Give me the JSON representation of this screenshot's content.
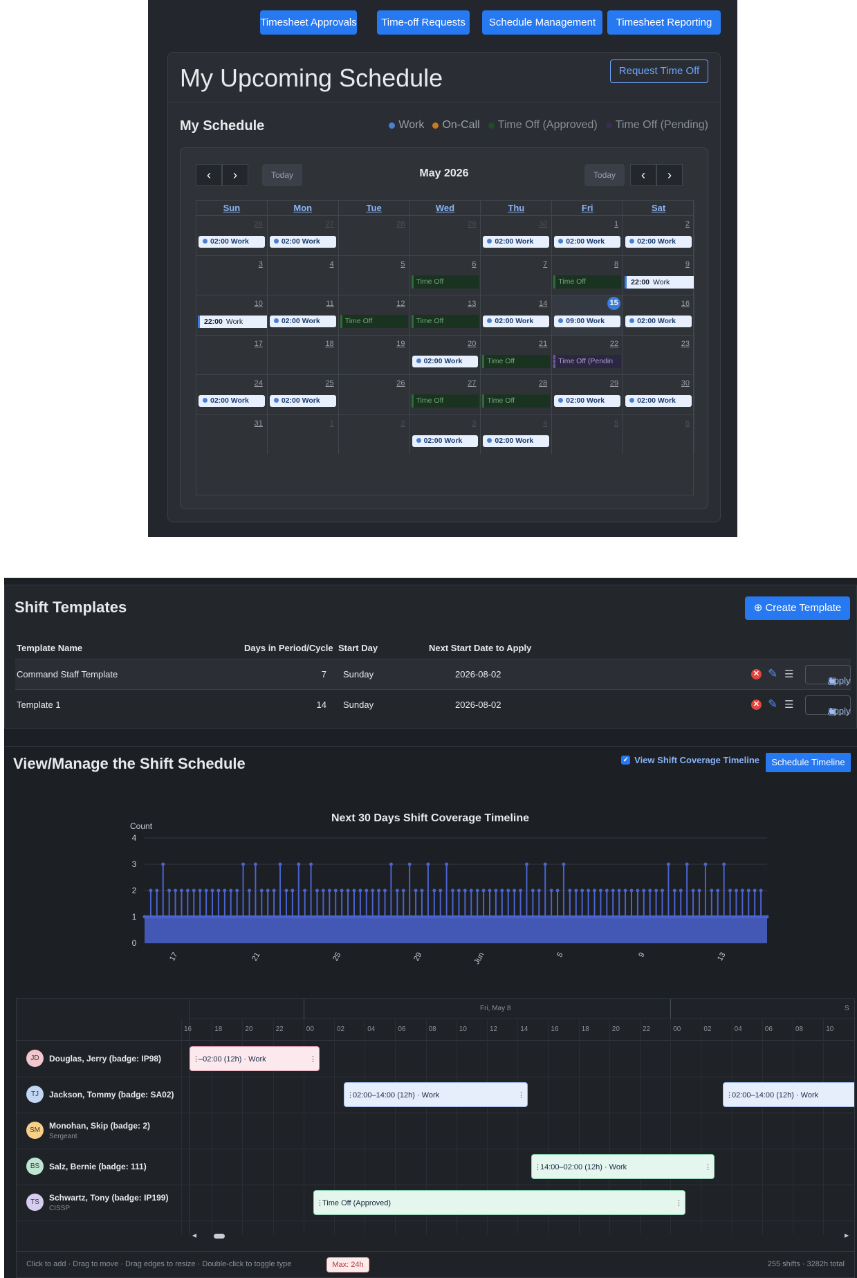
{
  "nav": {
    "buttons": [
      "Timesheet Approvals",
      "Time-off Requests",
      "Schedule Management",
      "Timesheet Reporting"
    ]
  },
  "schedule": {
    "title": "My Upcoming Schedule",
    "request_time_off": "Request Time Off",
    "subtitle": "My Schedule",
    "legend": [
      {
        "label": "Work",
        "color": "#4a7fd1"
      },
      {
        "label": "On-Call",
        "color": "#c77a1e"
      },
      {
        "label": "Time Off (Approved)",
        "color": "#1e4d26"
      },
      {
        "label": "Time Off (Pending)",
        "color": "#3a2d55"
      }
    ],
    "today_label": "Today",
    "month_label": "May 2026",
    "weekdays": [
      "Sun",
      "Mon",
      "Tue",
      "Wed",
      "Thu",
      "Fri",
      "Sat"
    ],
    "weeks": [
      [
        {
          "day": "26",
          "other": true,
          "ev": "w",
          "text": "02:00 Work"
        },
        {
          "day": "27",
          "other": true,
          "ev": "w",
          "text": "02:00 Work"
        },
        {
          "day": "28",
          "other": true
        },
        {
          "day": "29",
          "other": true
        },
        {
          "day": "30",
          "other": true,
          "ev": "w",
          "text": "02:00 Work"
        },
        {
          "day": "1",
          "ev": "w",
          "text": "02:00 Work"
        },
        {
          "day": "2",
          "ev": "w",
          "text": "02:00 Work"
        }
      ],
      [
        {
          "day": "3"
        },
        {
          "day": "4"
        },
        {
          "day": "5"
        },
        {
          "day": "6",
          "ev": "to",
          "text": "Time Off"
        },
        {
          "day": "7"
        },
        {
          "day": "8",
          "ev": "to",
          "text": "Time Off"
        },
        {
          "day": "9",
          "ev": "n",
          "time": "22:00",
          "text": "Work"
        }
      ],
      [
        {
          "day": "10",
          "ev": "n",
          "time": "22:00",
          "text": "Work"
        },
        {
          "day": "11",
          "ev": "w",
          "text": "02:00 Work"
        },
        {
          "day": "12",
          "ev": "to",
          "text": "Time Off"
        },
        {
          "day": "13",
          "ev": "to",
          "text": "Time Off"
        },
        {
          "day": "14",
          "ev": "w",
          "text": "02:00 Work"
        },
        {
          "day": "15",
          "today": true,
          "ev": "w",
          "text": "09:00 Work"
        },
        {
          "day": "16",
          "ev": "w",
          "text": "02:00 Work"
        }
      ],
      [
        {
          "day": "17"
        },
        {
          "day": "18"
        },
        {
          "day": "19"
        },
        {
          "day": "20",
          "ev": "w",
          "text": "02:00 Work"
        },
        {
          "day": "21",
          "ev": "to",
          "text": "Time Off"
        },
        {
          "day": "22",
          "ev": "tp",
          "text": "Time Off (Pendin"
        },
        {
          "day": "23"
        }
      ],
      [
        {
          "day": "24",
          "ev": "w",
          "text": "02:00 Work"
        },
        {
          "day": "25",
          "ev": "w",
          "text": "02:00 Work"
        },
        {
          "day": "26"
        },
        {
          "day": "27",
          "ev": "to",
          "text": "Time Off"
        },
        {
          "day": "28",
          "ev": "to",
          "text": "Time Off"
        },
        {
          "day": "29",
          "ev": "w",
          "text": "02:00 Work"
        },
        {
          "day": "30",
          "ev": "w",
          "text": "02:00 Work"
        }
      ],
      [
        {
          "day": "31"
        },
        {
          "day": "1",
          "other": true
        },
        {
          "day": "2",
          "other": true
        },
        {
          "day": "3",
          "other": true,
          "ev": "w",
          "text": "02:00 Work"
        },
        {
          "day": "4",
          "other": true,
          "ev": "w",
          "text": "02:00 Work"
        },
        {
          "day": "5",
          "other": true
        },
        {
          "day": "6",
          "other": true
        }
      ]
    ]
  },
  "templates": {
    "title": "Shift Templates",
    "create_label": "Create Template",
    "columns": [
      "Template Name",
      "Days in Period/Cycle",
      "Start Day",
      "Next Start Date to Apply"
    ],
    "rows": [
      {
        "name": "Command Staff Template",
        "days": "7",
        "start_day": "Sunday",
        "next": "2026-08-02"
      },
      {
        "name": "Template 1",
        "days": "14",
        "start_day": "Sunday",
        "next": "2026-08-02"
      }
    ],
    "apply_label": "Apply"
  },
  "manage": {
    "title": "View/Manage the Shift Schedule",
    "checkbox_label": "View Shift Coverage Timeline",
    "schedule_timeline_label": "Schedule Timeline"
  },
  "chart_data": {
    "type": "area",
    "title": "Next 30 Days Shift Coverage Timeline",
    "ylabel": "Count",
    "xlabel": "",
    "ylim": [
      0,
      4
    ],
    "yticks": [
      "0",
      "1",
      "2",
      "3",
      "4"
    ],
    "xticks": [
      "17",
      "21",
      "25",
      "29",
      "Jun",
      "5",
      "9",
      "13"
    ],
    "series": [
      {
        "values": [
          1,
          2,
          2,
          3,
          2,
          2,
          2,
          2,
          2,
          2,
          2,
          2,
          2,
          2,
          2,
          2,
          3,
          2,
          3,
          2,
          2,
          2,
          3,
          2,
          2,
          3,
          2,
          3,
          2,
          2,
          2,
          2,
          2,
          2,
          2,
          2,
          2,
          2,
          2,
          2,
          3,
          2,
          2,
          3,
          2,
          2,
          3,
          2,
          2,
          3,
          2,
          2,
          2,
          2,
          2,
          2,
          2,
          2,
          2,
          2,
          2,
          2,
          3,
          2,
          2,
          3,
          2,
          2,
          3,
          2,
          2,
          2,
          2,
          2,
          2,
          2,
          2,
          2,
          2,
          2,
          2,
          2,
          2,
          2,
          2,
          3,
          2,
          2,
          3,
          2,
          2,
          3,
          2,
          2,
          3,
          2,
          2,
          2,
          2,
          2,
          2,
          1
        ]
      }
    ]
  },
  "timeline": {
    "date_label": "Fri, May 8",
    "next_date_label": "S",
    "hours": [
      "16",
      "18",
      "20",
      "22",
      "00",
      "02",
      "04",
      "06",
      "08",
      "10",
      "12",
      "14",
      "16",
      "18",
      "20",
      "22",
      "00",
      "02",
      "04",
      "06",
      "08",
      "10"
    ],
    "people": [
      {
        "initials": "JD",
        "name": "Douglas, Jerry (badge: IP98)",
        "sub": "",
        "color": "#f4c6cf"
      },
      {
        "initials": "TJ",
        "name": "Jackson, Tommy (badge: SA02)",
        "sub": "",
        "color": "#c3d7f5"
      },
      {
        "initials": "SM",
        "name": "Monohan, Skip (badge: 2)",
        "sub": "Sergeant",
        "color": "#f7cf86"
      },
      {
        "initials": "BS",
        "name": "Salz, Bernie (badge: 111)",
        "sub": "",
        "color": "#bfe6d2"
      },
      {
        "initials": "TS",
        "name": "Schwartz, Tony (badge: IP199)",
        "sub": "CISSP",
        "color": "#d6cdf1"
      }
    ],
    "bars": [
      {
        "text": "–02:00 (12h) · Work",
        "color": "#fbe9ee",
        "border": "#e6a3b2"
      },
      {
        "text": "02:00–14:00 (12h) · Work",
        "color": "#e6eefb",
        "border": "#9bb8e6"
      },
      {
        "text": "02:00–14:00 (12h) · Work",
        "color": "#e6eefb",
        "border": "#9bb8e6"
      },
      {
        "text": "14:00–02:00 (12h) · Work",
        "color": "#e5f6ee",
        "border": "#8ccfae"
      },
      {
        "text": "Time Off (Approved)",
        "color": "#e5f6ee",
        "border": "#8ccfae"
      }
    ],
    "footer_hint": "Click to add · Drag to move · Drag edges to resize · Double-click to toggle type",
    "max_label": "Max: 24h",
    "summary": "255 shifts · 3282h total"
  }
}
